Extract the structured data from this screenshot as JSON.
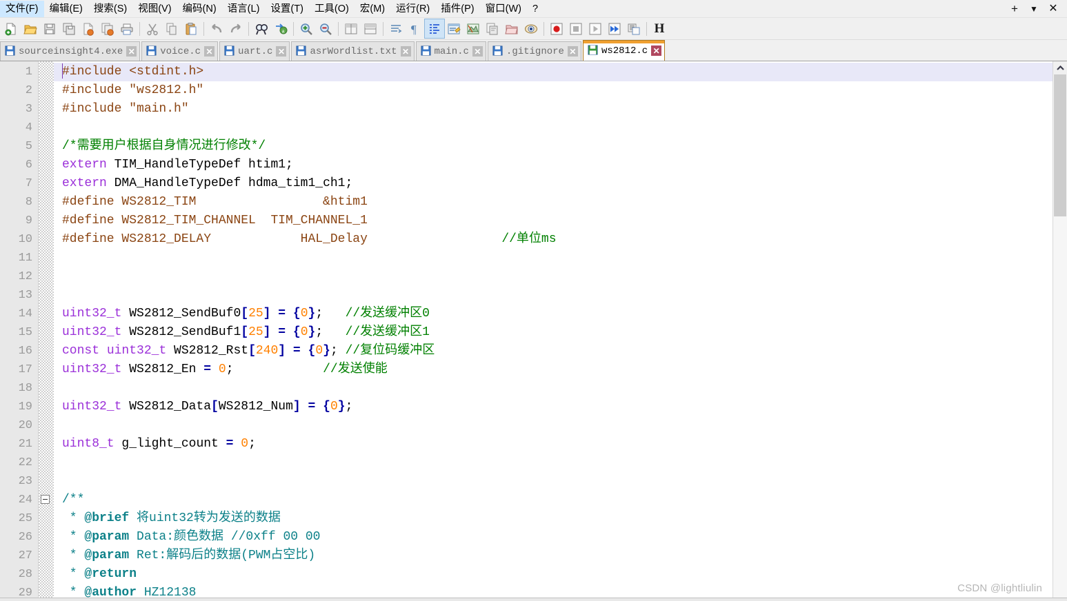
{
  "window": {
    "controls": [
      {
        "name": "add-tab-button",
        "glyph": "+"
      },
      {
        "name": "dropdown-button",
        "glyph": "▼"
      },
      {
        "name": "close-button",
        "glyph": "✕"
      }
    ]
  },
  "menubar": {
    "items": [
      {
        "label": "文件(F)",
        "name": "menu-file"
      },
      {
        "label": "编辑(E)",
        "name": "menu-edit"
      },
      {
        "label": "搜索(S)",
        "name": "menu-search"
      },
      {
        "label": "视图(V)",
        "name": "menu-view"
      },
      {
        "label": "编码(N)",
        "name": "menu-encoding"
      },
      {
        "label": "语言(L)",
        "name": "menu-language"
      },
      {
        "label": "设置(T)",
        "name": "menu-settings"
      },
      {
        "label": "工具(O)",
        "name": "menu-tools"
      },
      {
        "label": "宏(M)",
        "name": "menu-macro"
      },
      {
        "label": "运行(R)",
        "name": "menu-run"
      },
      {
        "label": "插件(P)",
        "name": "menu-plugins"
      },
      {
        "label": "窗口(W)",
        "name": "menu-window"
      },
      {
        "label": "?",
        "name": "menu-help"
      }
    ]
  },
  "toolbar": {
    "items": [
      {
        "name": "new-file-icon",
        "type": "icon"
      },
      {
        "name": "open-file-icon",
        "type": "icon"
      },
      {
        "name": "save-icon",
        "type": "icon"
      },
      {
        "name": "save-all-icon",
        "type": "icon"
      },
      {
        "name": "close-file-icon",
        "type": "icon"
      },
      {
        "name": "close-all-files-icon",
        "type": "icon"
      },
      {
        "name": "print-icon",
        "type": "icon"
      },
      {
        "name": "separator-1",
        "type": "sep"
      },
      {
        "name": "cut-icon",
        "type": "icon"
      },
      {
        "name": "copy-icon",
        "type": "icon"
      },
      {
        "name": "paste-icon",
        "type": "icon"
      },
      {
        "name": "separator-2",
        "type": "sep"
      },
      {
        "name": "undo-icon",
        "type": "icon"
      },
      {
        "name": "redo-icon",
        "type": "icon"
      },
      {
        "name": "separator-3",
        "type": "sep"
      },
      {
        "name": "find-icon",
        "type": "icon"
      },
      {
        "name": "replace-icon",
        "type": "icon"
      },
      {
        "name": "separator-4",
        "type": "sep"
      },
      {
        "name": "zoom-in-icon",
        "type": "icon"
      },
      {
        "name": "zoom-out-icon",
        "type": "icon"
      },
      {
        "name": "separator-5",
        "type": "sep"
      },
      {
        "name": "sync-vertical-scroll-icon",
        "type": "icon"
      },
      {
        "name": "sync-horizontal-scroll-icon",
        "type": "icon"
      },
      {
        "name": "separator-6",
        "type": "sep"
      },
      {
        "name": "word-wrap-icon",
        "type": "icon"
      },
      {
        "name": "show-all-characters-icon",
        "type": "icon"
      },
      {
        "name": "indent-guide-icon",
        "type": "icon",
        "active": true
      },
      {
        "name": "user-defined-language-icon",
        "type": "icon"
      },
      {
        "name": "document-map-icon",
        "type": "icon"
      },
      {
        "name": "function-list-icon",
        "type": "icon"
      },
      {
        "name": "folder-as-workspace-icon",
        "type": "icon"
      },
      {
        "name": "monitoring-icon",
        "type": "icon"
      },
      {
        "name": "separator-7",
        "type": "sep"
      },
      {
        "name": "macro-record-icon",
        "type": "icon"
      },
      {
        "name": "macro-stop-icon",
        "type": "icon"
      },
      {
        "name": "macro-play-icon",
        "type": "icon"
      },
      {
        "name": "macro-run-multiple-icon",
        "type": "icon"
      },
      {
        "name": "macro-save-icon",
        "type": "icon"
      },
      {
        "name": "separator-8",
        "type": "sep"
      },
      {
        "name": "hex-editor-icon",
        "type": "icon",
        "glyph": "H"
      }
    ]
  },
  "tabs": [
    {
      "label": "sourceinsight4.exe",
      "active": false,
      "close": "✕"
    },
    {
      "label": "voice.c",
      "active": false,
      "close": "✕"
    },
    {
      "label": "uart.c",
      "active": false,
      "close": "✕"
    },
    {
      "label": "asrWordlist.txt",
      "active": false,
      "close": "✕"
    },
    {
      "label": "main.c",
      "active": false,
      "close": "✕"
    },
    {
      "label": ".gitignore",
      "active": false,
      "close": "✕"
    },
    {
      "label": "ws2812.c",
      "active": true,
      "close": "✕"
    }
  ],
  "editor": {
    "current_line": 1,
    "first_line_number": 1,
    "line_count": 29,
    "lines": [
      {
        "n": 1,
        "tokens": [
          {
            "t": "#include <stdint.h>",
            "c": "pp"
          }
        ]
      },
      {
        "n": 2,
        "tokens": [
          {
            "t": "#include \"ws2812.h\"",
            "c": "pp"
          }
        ]
      },
      {
        "n": 3,
        "tokens": [
          {
            "t": "#include \"main.h\"",
            "c": "pp"
          }
        ]
      },
      {
        "n": 4,
        "tokens": []
      },
      {
        "n": 5,
        "tokens": [
          {
            "t": "/*需要用户根据自身情况进行修改*/",
            "c": "cmt"
          }
        ]
      },
      {
        "n": 6,
        "tokens": [
          {
            "t": "extern",
            "c": "kw"
          },
          {
            "t": " TIM_HandleTypeDef htim1;",
            "c": "id"
          }
        ]
      },
      {
        "n": 7,
        "tokens": [
          {
            "t": "extern",
            "c": "kw"
          },
          {
            "t": " DMA_HandleTypeDef hdma_tim1_ch1;",
            "c": "id"
          }
        ]
      },
      {
        "n": 8,
        "tokens": [
          {
            "t": "#define WS2812_TIM                 &htim1",
            "c": "pp"
          }
        ]
      },
      {
        "n": 9,
        "tokens": [
          {
            "t": "#define WS2812_TIM_CHANNEL  TIM_CHANNEL_1",
            "c": "pp"
          }
        ]
      },
      {
        "n": 10,
        "tokens": [
          {
            "t": "#define WS2812_DELAY            HAL_Delay",
            "c": "pp"
          },
          {
            "t": "                  ",
            "c": "id"
          },
          {
            "t": "//单位ms",
            "c": "cmt"
          }
        ]
      },
      {
        "n": 11,
        "tokens": []
      },
      {
        "n": 12,
        "tokens": []
      },
      {
        "n": 13,
        "tokens": []
      },
      {
        "n": 14,
        "tokens": [
          {
            "t": "uint32_t",
            "c": "kw"
          },
          {
            "t": " WS2812_SendBuf0",
            "c": "id"
          },
          {
            "t": "[",
            "c": "op"
          },
          {
            "t": "25",
            "c": "num"
          },
          {
            "t": "]",
            "c": "op"
          },
          {
            "t": " ",
            "c": "id"
          },
          {
            "t": "=",
            "c": "op"
          },
          {
            "t": " ",
            "c": "id"
          },
          {
            "t": "{",
            "c": "op"
          },
          {
            "t": "0",
            "c": "num"
          },
          {
            "t": "}",
            "c": "op"
          },
          {
            "t": ";   ",
            "c": "id"
          },
          {
            "t": "//发送缓冲区0",
            "c": "cmt"
          }
        ]
      },
      {
        "n": 15,
        "tokens": [
          {
            "t": "uint32_t",
            "c": "kw"
          },
          {
            "t": " WS2812_SendBuf1",
            "c": "id"
          },
          {
            "t": "[",
            "c": "op"
          },
          {
            "t": "25",
            "c": "num"
          },
          {
            "t": "]",
            "c": "op"
          },
          {
            "t": " ",
            "c": "id"
          },
          {
            "t": "=",
            "c": "op"
          },
          {
            "t": " ",
            "c": "id"
          },
          {
            "t": "{",
            "c": "op"
          },
          {
            "t": "0",
            "c": "num"
          },
          {
            "t": "}",
            "c": "op"
          },
          {
            "t": ";   ",
            "c": "id"
          },
          {
            "t": "//发送缓冲区1",
            "c": "cmt"
          }
        ]
      },
      {
        "n": 16,
        "tokens": [
          {
            "t": "const",
            "c": "kw"
          },
          {
            "t": " ",
            "c": "id"
          },
          {
            "t": "uint32_t",
            "c": "kw"
          },
          {
            "t": " WS2812_Rst",
            "c": "id"
          },
          {
            "t": "[",
            "c": "op"
          },
          {
            "t": "240",
            "c": "num"
          },
          {
            "t": "]",
            "c": "op"
          },
          {
            "t": " ",
            "c": "id"
          },
          {
            "t": "=",
            "c": "op"
          },
          {
            "t": " ",
            "c": "id"
          },
          {
            "t": "{",
            "c": "op"
          },
          {
            "t": "0",
            "c": "num"
          },
          {
            "t": "}",
            "c": "op"
          },
          {
            "t": "; ",
            "c": "id"
          },
          {
            "t": "//复位码缓冲区",
            "c": "cmt"
          }
        ]
      },
      {
        "n": 17,
        "tokens": [
          {
            "t": "uint32_t",
            "c": "kw"
          },
          {
            "t": " WS2812_En ",
            "c": "id"
          },
          {
            "t": "=",
            "c": "op"
          },
          {
            "t": " ",
            "c": "id"
          },
          {
            "t": "0",
            "c": "num"
          },
          {
            "t": ";            ",
            "c": "id"
          },
          {
            "t": "//发送使能",
            "c": "cmt"
          }
        ]
      },
      {
        "n": 18,
        "tokens": []
      },
      {
        "n": 19,
        "tokens": [
          {
            "t": "uint32_t",
            "c": "kw"
          },
          {
            "t": " WS2812_Data",
            "c": "id"
          },
          {
            "t": "[",
            "c": "op"
          },
          {
            "t": "WS2812_Num",
            "c": "id"
          },
          {
            "t": "]",
            "c": "op"
          },
          {
            "t": " ",
            "c": "id"
          },
          {
            "t": "=",
            "c": "op"
          },
          {
            "t": " ",
            "c": "id"
          },
          {
            "t": "{",
            "c": "op"
          },
          {
            "t": "0",
            "c": "num"
          },
          {
            "t": "}",
            "c": "op"
          },
          {
            "t": ";",
            "c": "id"
          }
        ]
      },
      {
        "n": 20,
        "tokens": []
      },
      {
        "n": 21,
        "tokens": [
          {
            "t": "uint8_t",
            "c": "kw"
          },
          {
            "t": " g_light_count ",
            "c": "id"
          },
          {
            "t": "=",
            "c": "op"
          },
          {
            "t": " ",
            "c": "id"
          },
          {
            "t": "0",
            "c": "num"
          },
          {
            "t": ";",
            "c": "id"
          }
        ]
      },
      {
        "n": 22,
        "tokens": []
      },
      {
        "n": 23,
        "tokens": []
      },
      {
        "n": 24,
        "tokens": [
          {
            "t": "/**",
            "c": "doc"
          }
        ],
        "fold": true
      },
      {
        "n": 25,
        "tokens": [
          {
            "t": " * ",
            "c": "doc"
          },
          {
            "t": "@brief",
            "c": "docb"
          },
          {
            "t": " 将uint32转为发送的数据",
            "c": "doc"
          }
        ]
      },
      {
        "n": 26,
        "tokens": [
          {
            "t": " * ",
            "c": "doc"
          },
          {
            "t": "@param",
            "c": "docb"
          },
          {
            "t": " Data:颜色数据 //0xff 00 00",
            "c": "doc"
          }
        ]
      },
      {
        "n": 27,
        "tokens": [
          {
            "t": " * ",
            "c": "doc"
          },
          {
            "t": "@param",
            "c": "docb"
          },
          {
            "t": " Ret:解码后的数据(PWM占空比)",
            "c": "doc"
          }
        ]
      },
      {
        "n": 28,
        "tokens": [
          {
            "t": " * ",
            "c": "doc"
          },
          {
            "t": "@return",
            "c": "docb"
          }
        ]
      },
      {
        "n": 29,
        "tokens": [
          {
            "t": " * ",
            "c": "doc"
          },
          {
            "t": "@author",
            "c": "docb"
          },
          {
            "t": " HZ12138",
            "c": "doc"
          }
        ]
      }
    ]
  },
  "scrollbar": {
    "up_arrow": "▲",
    "thumb_top_pct": 0,
    "thumb_height_pct": 27
  },
  "watermark": {
    "text": "CSDN @lightliulin"
  },
  "colors": {
    "preprocessor": "#8b4513",
    "comment": "#008000",
    "doc_comment": "#0d8189",
    "keyword": "#9b30d9",
    "number": "#ff8000",
    "operator": "#0000a0",
    "current_line_bg": "#e8e8f8",
    "active_tab_accent": "#f0a030",
    "gutter_bg": "#e8e8e8"
  }
}
